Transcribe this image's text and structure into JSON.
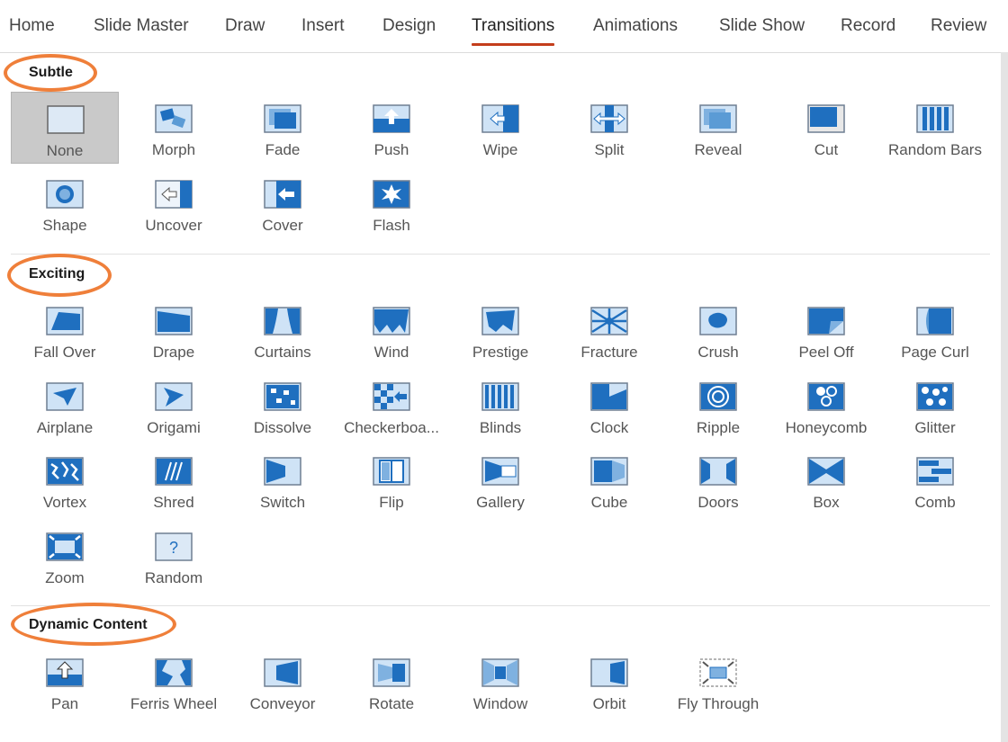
{
  "tabs": [
    "Home",
    "Slide Master",
    "Draw",
    "Insert",
    "Design",
    "Transitions",
    "Animations",
    "Slide Show",
    "Record",
    "Review"
  ],
  "active_tab": "Transitions",
  "sections": [
    {
      "title": "Subtle",
      "items": [
        {
          "label": "None",
          "icon": "none-icon",
          "selected": true
        },
        {
          "label": "Morph",
          "icon": "morph-icon"
        },
        {
          "label": "Fade",
          "icon": "fade-icon"
        },
        {
          "label": "Push",
          "icon": "push-icon"
        },
        {
          "label": "Wipe",
          "icon": "wipe-icon"
        },
        {
          "label": "Split",
          "icon": "split-icon"
        },
        {
          "label": "Reveal",
          "icon": "reveal-icon"
        },
        {
          "label": "Cut",
          "icon": "cut-icon"
        },
        {
          "label": "Random Bars",
          "icon": "random-bars-icon"
        },
        {
          "label": "Shape",
          "icon": "shape-icon"
        },
        {
          "label": "Uncover",
          "icon": "uncover-icon"
        },
        {
          "label": "Cover",
          "icon": "cover-icon"
        },
        {
          "label": "Flash",
          "icon": "flash-icon"
        }
      ]
    },
    {
      "title": "Exciting",
      "items": [
        {
          "label": "Fall Over",
          "icon": "fall-over-icon"
        },
        {
          "label": "Drape",
          "icon": "drape-icon"
        },
        {
          "label": "Curtains",
          "icon": "curtains-icon"
        },
        {
          "label": "Wind",
          "icon": "wind-icon"
        },
        {
          "label": "Prestige",
          "icon": "prestige-icon"
        },
        {
          "label": "Fracture",
          "icon": "fracture-icon"
        },
        {
          "label": "Crush",
          "icon": "crush-icon"
        },
        {
          "label": "Peel Off",
          "icon": "peel-off-icon"
        },
        {
          "label": "Page Curl",
          "icon": "page-curl-icon"
        },
        {
          "label": "Airplane",
          "icon": "airplane-icon"
        },
        {
          "label": "Origami",
          "icon": "origami-icon"
        },
        {
          "label": "Dissolve",
          "icon": "dissolve-icon"
        },
        {
          "label": "Checkerboa...",
          "icon": "checkerboard-icon"
        },
        {
          "label": "Blinds",
          "icon": "blinds-icon"
        },
        {
          "label": "Clock",
          "icon": "clock-icon"
        },
        {
          "label": "Ripple",
          "icon": "ripple-icon"
        },
        {
          "label": "Honeycomb",
          "icon": "honeycomb-icon"
        },
        {
          "label": "Glitter",
          "icon": "glitter-icon"
        },
        {
          "label": "Vortex",
          "icon": "vortex-icon"
        },
        {
          "label": "Shred",
          "icon": "shred-icon"
        },
        {
          "label": "Switch",
          "icon": "switch-icon"
        },
        {
          "label": "Flip",
          "icon": "flip-icon"
        },
        {
          "label": "Gallery",
          "icon": "gallery-icon"
        },
        {
          "label": "Cube",
          "icon": "cube-icon"
        },
        {
          "label": "Doors",
          "icon": "doors-icon"
        },
        {
          "label": "Box",
          "icon": "box-icon"
        },
        {
          "label": "Comb",
          "icon": "comb-icon"
        },
        {
          "label": "Zoom",
          "icon": "zoom-icon"
        },
        {
          "label": "Random",
          "icon": "random-icon"
        }
      ]
    },
    {
      "title": "Dynamic Content",
      "items": [
        {
          "label": "Pan",
          "icon": "pan-icon"
        },
        {
          "label": "Ferris Wheel",
          "icon": "ferris-wheel-icon"
        },
        {
          "label": "Conveyor",
          "icon": "conveyor-icon"
        },
        {
          "label": "Rotate",
          "icon": "rotate-icon"
        },
        {
          "label": "Window",
          "icon": "window-icon"
        },
        {
          "label": "Orbit",
          "icon": "orbit-icon"
        },
        {
          "label": "Fly Through",
          "icon": "fly-through-icon"
        }
      ]
    }
  ],
  "colors": {
    "accent_underline": "#c43e1c",
    "annotation_ring": "#ef7f3a",
    "icon_blue": "#1f6fbf",
    "icon_light": "#cfe3f6",
    "selected_bg": "#c9c9c9"
  }
}
